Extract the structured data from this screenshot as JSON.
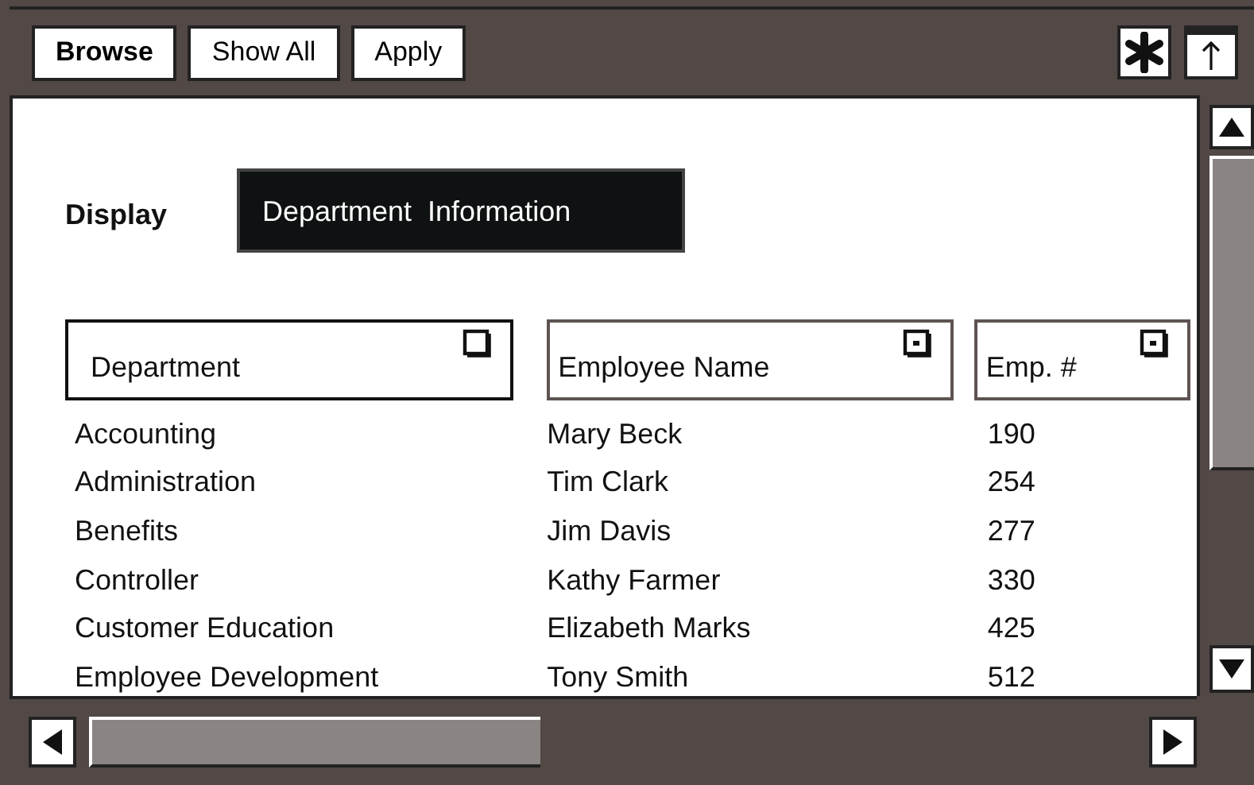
{
  "toolbar": {
    "buttons": [
      {
        "label": "Browse",
        "selected": true
      },
      {
        "label": "Show All",
        "selected": false
      },
      {
        "label": "Apply",
        "selected": false
      }
    ]
  },
  "display": {
    "label": "Display",
    "value": "Department  Information"
  },
  "table": {
    "columns": [
      {
        "label": "Department",
        "selected": true
      },
      {
        "label": "Employee Name",
        "selected": false
      },
      {
        "label": "Emp. #",
        "selected": false
      }
    ],
    "rows": [
      [
        "Accounting",
        "Mary Beck",
        "190"
      ],
      [
        "Administration",
        "Tim Clark",
        "254"
      ],
      [
        "Benefits",
        "Jim Davis",
        "277"
      ],
      [
        "Controller",
        "Kathy Farmer",
        "330"
      ],
      [
        "Customer Education",
        "Elizabeth Marks",
        "425"
      ],
      [
        "Employee Development",
        "Tony Smith",
        "512"
      ]
    ]
  }
}
